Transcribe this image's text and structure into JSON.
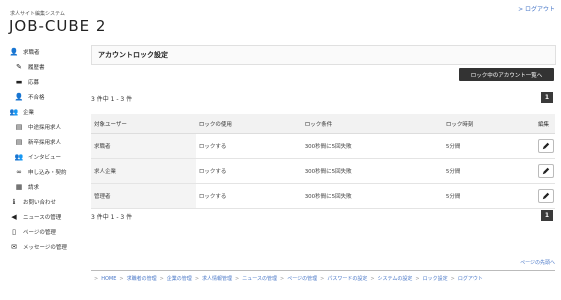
{
  "header": {
    "logout": "> ログアウト",
    "subtitle": "求人サイト編集システム",
    "title": "JOB-CUBE 2"
  },
  "sidebar": {
    "items": [
      {
        "label": "求職者",
        "icon": "user-icon",
        "level": "top"
      },
      {
        "label": "履歴書",
        "icon": "pencil-icon",
        "level": "sub"
      },
      {
        "label": "応募",
        "icon": "briefcase-icon",
        "level": "sub"
      },
      {
        "label": "不合格",
        "icon": "user-icon",
        "level": "sub"
      },
      {
        "label": "企業",
        "icon": "users-icon",
        "level": "top"
      },
      {
        "label": "中途採用求人",
        "icon": "book-icon",
        "level": "sub"
      },
      {
        "label": "新卒採用求人",
        "icon": "book-icon",
        "level": "sub"
      },
      {
        "label": "インタビュー",
        "icon": "users-icon",
        "level": "sub"
      },
      {
        "label": "申し込み・契約",
        "icon": "link-icon",
        "level": "sub"
      },
      {
        "label": "請求",
        "icon": "table-icon",
        "level": "sub"
      },
      {
        "label": "お問い合わせ",
        "icon": "info-icon",
        "level": "top"
      },
      {
        "label": "ニュースの管理",
        "icon": "megaphone-icon",
        "level": "top"
      },
      {
        "label": "ページの管理",
        "icon": "page-icon",
        "level": "top"
      },
      {
        "label": "メッセージの管理",
        "icon": "mail-icon",
        "level": "top"
      }
    ]
  },
  "main": {
    "panel_title": "アカウントロック設定",
    "locked_list_button": "ロック中のアカウント一覧へ",
    "count_top": "3 件中 1 - 3 件",
    "count_bottom": "3 件中 1 - 3 件",
    "page_number": "1",
    "table": {
      "headers": [
        "対象ユーザー",
        "ロックの使用",
        "ロック条件",
        "ロック時刻",
        "編集"
      ],
      "rows": [
        [
          "求職者",
          "ロックする",
          "300秒間に5回失敗",
          "5分間"
        ],
        [
          "求人企業",
          "ロックする",
          "300秒間に5回失敗",
          "5分間"
        ],
        [
          "管理者",
          "ロックする",
          "300秒間に5回失敗",
          "5分間"
        ]
      ]
    }
  },
  "footer": {
    "to_top": "ページの先頭へ",
    "breadcrumb": [
      "HOME",
      "求職者の管理",
      "企業の管理",
      "求人情報管理",
      "ニュースの管理",
      "ページの管理",
      "パスワードの設定",
      "システムの設定",
      "ロック設定",
      "ログアウト"
    ],
    "sep": ">"
  }
}
